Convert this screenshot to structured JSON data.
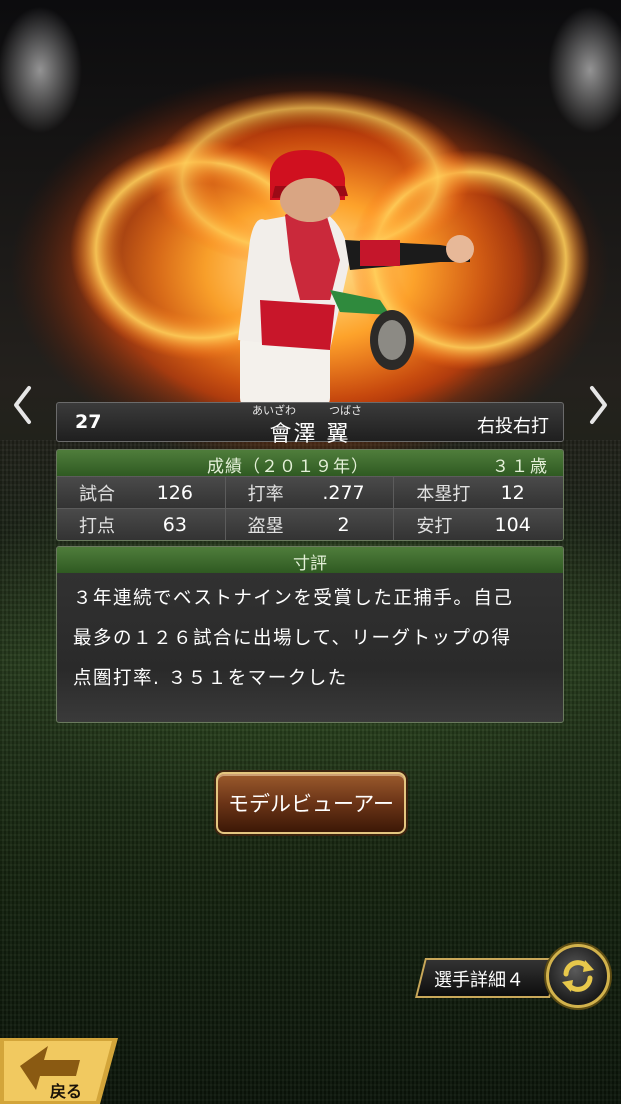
{
  "player": {
    "number": "27",
    "reading_family": "あいざわ",
    "reading_given": "つばさ",
    "name": "會澤 翼",
    "handedness": "右投右打"
  },
  "stats": {
    "title": "成績（２０１９年）",
    "age": "３１歳",
    "rows": [
      [
        {
          "label": "試合",
          "value": "126"
        },
        {
          "label": "打率",
          "value": ".277"
        },
        {
          "label": "本塁打",
          "value": "12"
        }
      ],
      [
        {
          "label": "打点",
          "value": "63"
        },
        {
          "label": "盗塁",
          "value": "2"
        },
        {
          "label": "安打",
          "value": "104"
        }
      ]
    ]
  },
  "review": {
    "title": "寸評",
    "lines": [
      "３年連続でベストナインを受賞した正捕手。自己",
      "最多の１２６試合に出場して、リーグトップの得",
      "点圏打率. ３５１をマークした"
    ]
  },
  "buttons": {
    "model_viewer": "モデルビューアー",
    "player_detail": "選手詳細４",
    "back": "戻る"
  },
  "icons": {
    "prev": "chevron-left-icon",
    "next": "chevron-right-icon",
    "swap": "swap-arrows-icon",
    "back": "back-arrow-icon"
  },
  "colors": {
    "section_header": "#3f6f2e",
    "button_gold": "#d2b24c",
    "model_button": "#6b3417"
  }
}
